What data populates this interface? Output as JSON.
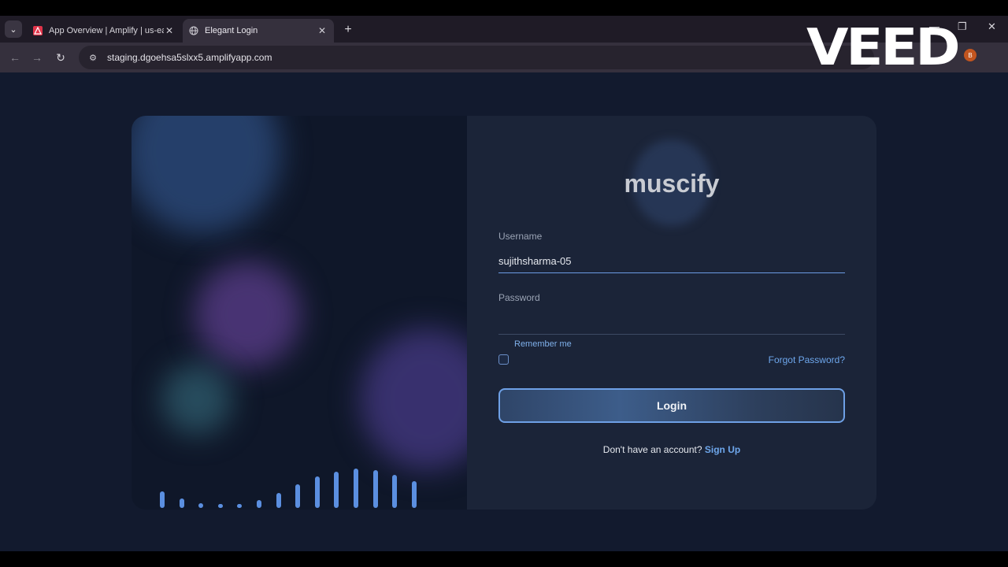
{
  "browser": {
    "tabs": [
      {
        "title": "App Overview | Amplify | us-ea",
        "favicon": "amplify-icon",
        "active": false
      },
      {
        "title": "Elegant Login",
        "favicon": "globe-icon",
        "active": true
      }
    ],
    "url": "staging.dgoehsa5slxx5.amplifyapp.com",
    "avatar_letter": "B",
    "accent_color": "#35303d"
  },
  "watermark": "VEED",
  "login": {
    "brand": "muscify",
    "username_label": "Username",
    "username_value": "sujithsharma-05",
    "password_label": "Password",
    "password_value": "",
    "remember_label": "Remember me",
    "remember_checked": false,
    "forgot_label": "Forgot Password?",
    "login_button": "Login",
    "signup_prompt": "Don't have an account?",
    "signup_link": "Sign Up",
    "accent_color": "#6ea7ec"
  },
  "visualizer_levels": [
    0.42,
    0.25,
    0.12,
    0.06,
    0.1,
    0.2,
    0.38,
    0.6,
    0.8,
    0.92,
    1.0,
    0.97,
    0.85,
    0.68
  ]
}
